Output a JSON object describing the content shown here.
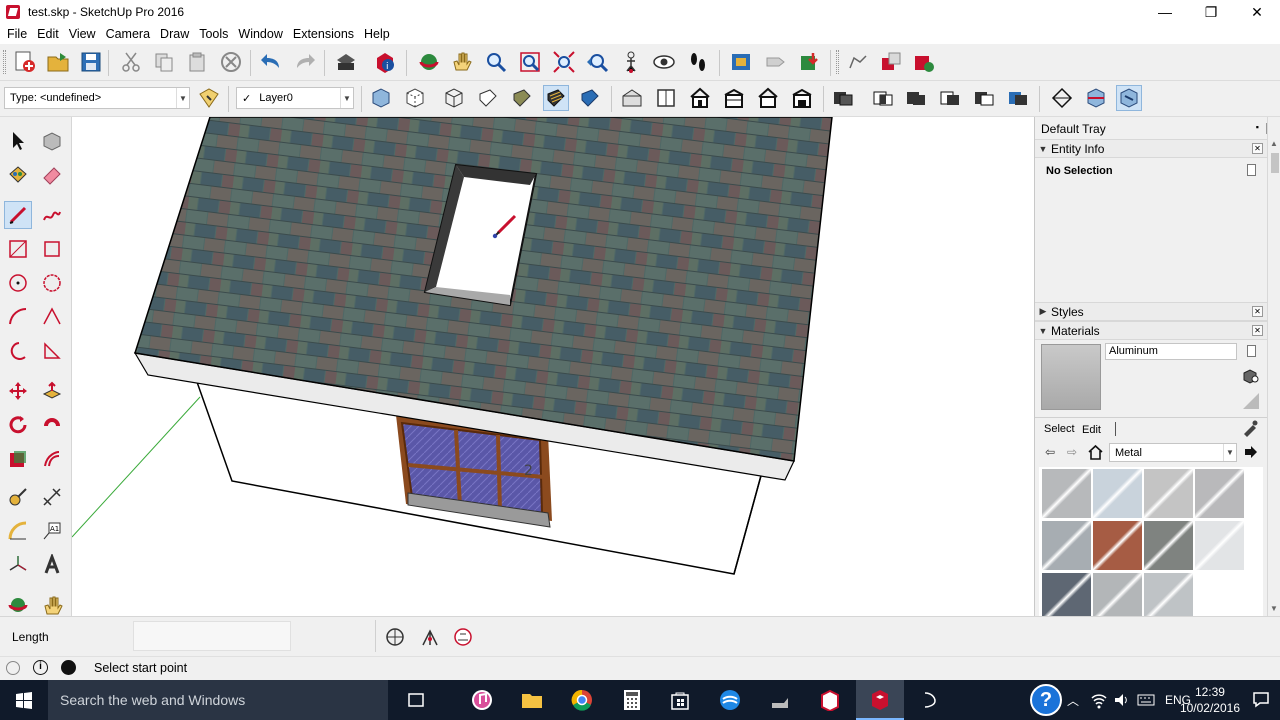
{
  "window": {
    "title": "test.skp - SketchUp Pro 2016",
    "minimize": "—",
    "maximize": "❐",
    "close": "✕"
  },
  "menu": [
    "File",
    "Edit",
    "View",
    "Camera",
    "Draw",
    "Tools",
    "Window",
    "Extensions",
    "Help"
  ],
  "toolbar": {
    "type_select": "Type: <undefined>",
    "layer_check": "✓",
    "layer_select": "Layer0"
  },
  "tray": {
    "title": "Default Tray",
    "pin": "▪",
    "entity_info": {
      "title": "Entity Info",
      "selection": "No Selection"
    },
    "styles": {
      "title": "Styles"
    },
    "materials": {
      "title": "Materials",
      "name": "Aluminum",
      "tabs": [
        "Select",
        "Edit"
      ],
      "library": "Metal",
      "swatch_colors": [
        "#b7b9bb",
        "#c9d3dc",
        "#c4c4c4",
        "#b9b9bb",
        "#a7adb2",
        "#a65c44",
        "#7f8380",
        "#e2e4e6",
        "#5e6773",
        "#b3b6b8",
        "#bfc3c6"
      ]
    }
  },
  "measurements": {
    "label": "Length",
    "value": ""
  },
  "status": {
    "message": "Select start point"
  },
  "taskbar": {
    "search_placeholder": "Search the web and Windows",
    "language": "ENG",
    "time": "12:39",
    "date": "10/02/2016",
    "help": "?"
  },
  "scene": {
    "window_label": "2"
  }
}
